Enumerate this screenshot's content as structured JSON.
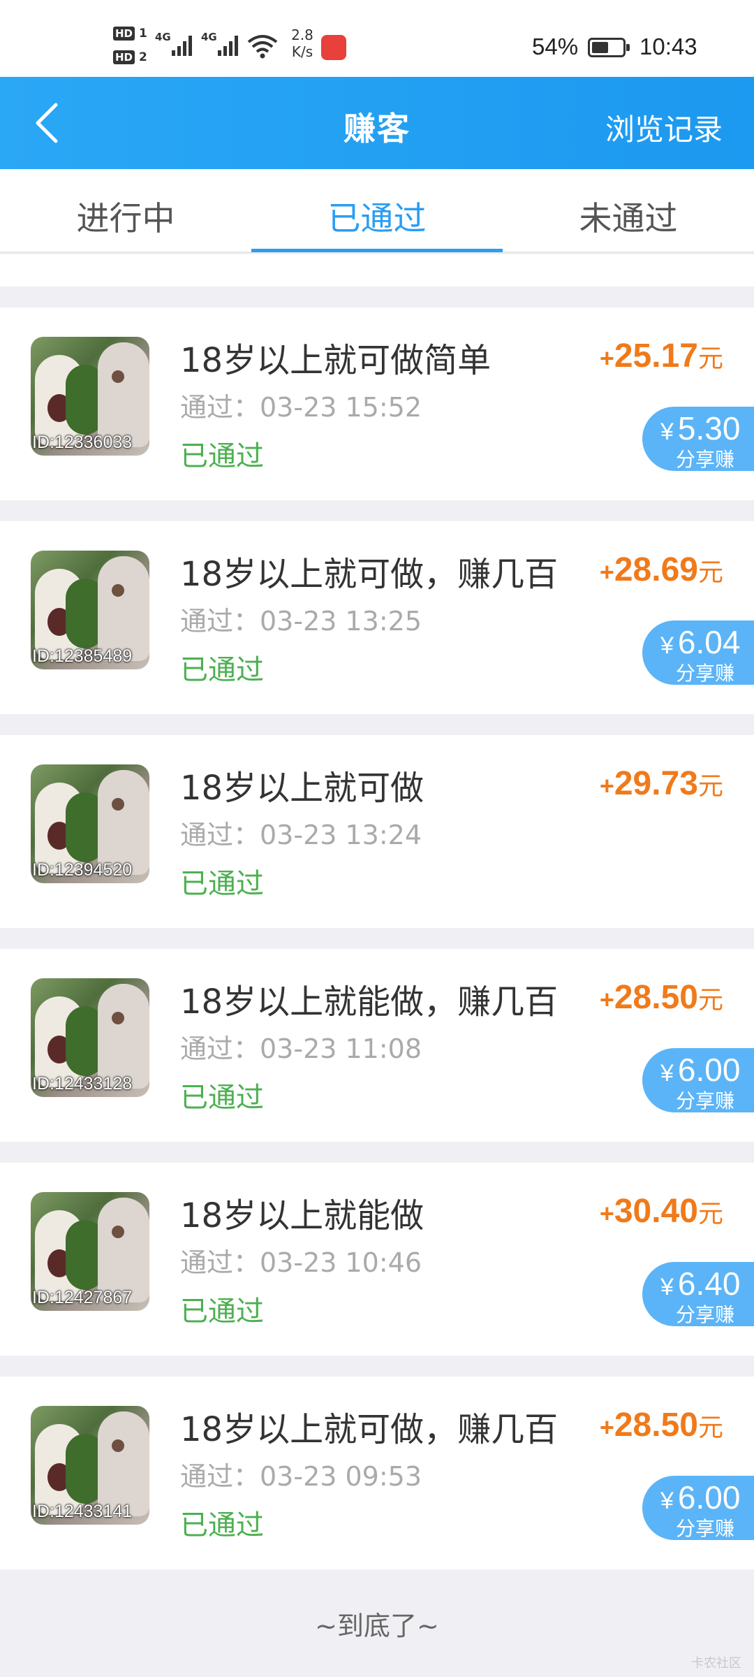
{
  "status_bar": {
    "hd1": "HD",
    "hd1_num": "1",
    "hd2": "HD",
    "hd2_num": "2",
    "sim1_type": "4G",
    "sim2_type": "4G",
    "speed_value": "2.8",
    "speed_unit": "K/s",
    "battery_percent": "54%",
    "battery_level": 0.54,
    "time": "10:43"
  },
  "header": {
    "title": "赚客",
    "history_label": "浏览记录"
  },
  "tabs": [
    {
      "label": "进行中",
      "active": false
    },
    {
      "label": "已通过",
      "active": true
    },
    {
      "label": "未通过",
      "active": false
    }
  ],
  "tasks": [
    {
      "id": "ID:12336033",
      "title": "18岁以上就可做简单",
      "time": "通过：03-23 15:52",
      "status": "已通过",
      "plus": "+",
      "amount": "25.17",
      "unit": "元",
      "share_yen": "¥",
      "share_amount": "5.30",
      "share_label": "分享赚",
      "has_share": true
    },
    {
      "id": "ID:12385489",
      "title": "18岁以上就可做，赚几百",
      "time": "通过：03-23 13:25",
      "status": "已通过",
      "plus": "+",
      "amount": "28.69",
      "unit": "元",
      "share_yen": "¥",
      "share_amount": "6.04",
      "share_label": "分享赚",
      "has_share": true
    },
    {
      "id": "ID:12394520",
      "title": "18岁以上就可做",
      "time": "通过：03-23 13:24",
      "status": "已通过",
      "plus": "+",
      "amount": "29.73",
      "unit": "元",
      "share_yen": "",
      "share_amount": "",
      "share_label": "",
      "has_share": false
    },
    {
      "id": "ID:12433128",
      "title": "18岁以上就能做，赚几百",
      "time": "通过：03-23 11:08",
      "status": "已通过",
      "plus": "+",
      "amount": "28.50",
      "unit": "元",
      "share_yen": "¥",
      "share_amount": "6.00",
      "share_label": "分享赚",
      "has_share": true
    },
    {
      "id": "ID:12427867",
      "title": "18岁以上就能做",
      "time": "通过：03-23 10:46",
      "status": "已通过",
      "plus": "+",
      "amount": "30.40",
      "unit": "元",
      "share_yen": "¥",
      "share_amount": "6.40",
      "share_label": "分享赚",
      "has_share": true
    },
    {
      "id": "ID:12433141",
      "title": "18岁以上就可做，赚几百",
      "time": "通过：03-23 09:53",
      "status": "已通过",
      "plus": "+",
      "amount": "28.50",
      "unit": "元",
      "share_yen": "¥",
      "share_amount": "6.00",
      "share_label": "分享赚",
      "has_share": true
    }
  ],
  "footer": {
    "end_text": "~到底了~"
  }
}
